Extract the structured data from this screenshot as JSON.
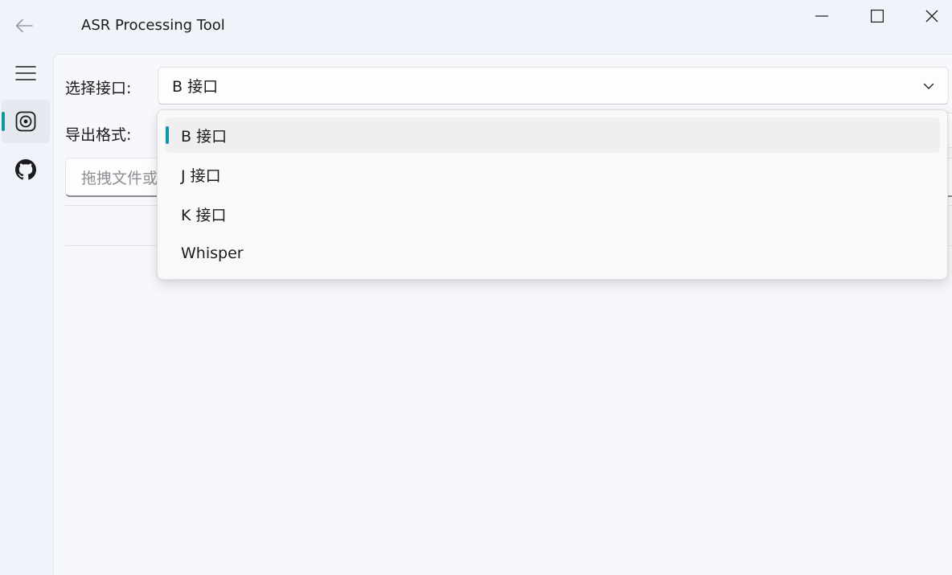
{
  "window": {
    "title": "ASR Processing Tool"
  },
  "nav": {
    "items": [
      {
        "icon": "menu-icon"
      },
      {
        "icon": "asr-icon",
        "selected": true
      },
      {
        "icon": "github-icon"
      }
    ]
  },
  "form": {
    "api_label": "选择接口:",
    "api_value": "B 接口",
    "format_label": "导出格式:",
    "drop_placeholder": "拖拽文件或"
  },
  "dropdown": {
    "options": [
      "B 接口",
      "J 接口",
      "K 接口",
      "Whisper"
    ],
    "selected_index": 0
  },
  "colors": {
    "accent": "#0f97a4",
    "background": "#f0f3f9",
    "panel": "#f6f8fc"
  }
}
